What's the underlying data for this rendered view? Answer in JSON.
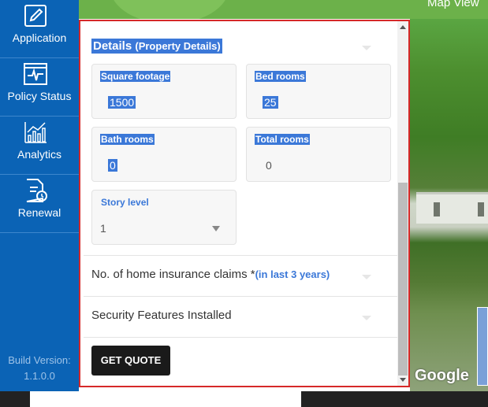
{
  "sidebar": {
    "items": [
      {
        "label": "Application",
        "icon": "edit-document-icon"
      },
      {
        "label": "Policy Status",
        "icon": "heartbeat-monitor-icon"
      },
      {
        "label": "Analytics",
        "icon": "bar-chart-icon"
      },
      {
        "label": "Renewal",
        "icon": "document-clock-icon"
      }
    ],
    "build_label": "Build Version:",
    "build_version": "1.1.0.0"
  },
  "map": {
    "tab_label": "Map View",
    "brand": "Google"
  },
  "details": {
    "title": "Details",
    "subtitle": "(Property Details)",
    "fields": {
      "square_footage": {
        "label": "Square footage",
        "value": "1500"
      },
      "bed_rooms": {
        "label": "Bed rooms",
        "value": "25"
      },
      "bath_rooms": {
        "label": "Bath rooms",
        "value": "0"
      },
      "total_rooms": {
        "label": "Total rooms",
        "value": "0"
      },
      "story_level": {
        "label": "Story level",
        "value": "1"
      }
    }
  },
  "claims": {
    "title": "No. of home insurance claims *",
    "hint": "(in last 3 years)"
  },
  "security": {
    "title": "Security Features Installed"
  },
  "actions": {
    "get_quote": "GET QUOTE"
  },
  "colors": {
    "sidebar": "#0b63b5",
    "accent": "#3b78d8",
    "panel_border": "#d62828",
    "button": "#1a1a1a"
  }
}
